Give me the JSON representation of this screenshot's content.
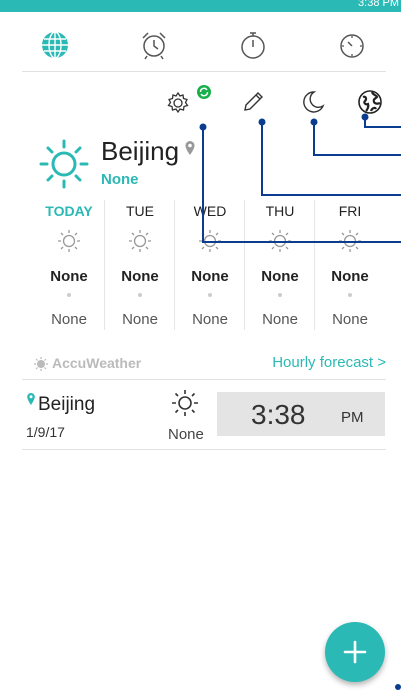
{
  "status_bar": {
    "time": "3:38 PM"
  },
  "tabs": [
    {
      "name": "world-clock",
      "icon": "globe-icon",
      "active": true
    },
    {
      "name": "alarm",
      "icon": "alarm-clock-icon"
    },
    {
      "name": "stopwatch",
      "icon": "stopwatch-icon"
    },
    {
      "name": "timer",
      "icon": "timer-icon"
    }
  ],
  "toolbar": [
    {
      "name": "settings",
      "icon": "gear-icon",
      "badge": "sync-badge"
    },
    {
      "name": "edit",
      "icon": "pencil-icon"
    },
    {
      "name": "night-mode",
      "icon": "moon-icon"
    },
    {
      "name": "add-city",
      "icon": "globe-icon"
    }
  ],
  "weather": {
    "city": "Beijing",
    "condition": "None",
    "forecast": [
      {
        "day": "TODAY",
        "high": "None",
        "low": "None"
      },
      {
        "day": "TUE",
        "high": "None",
        "low": "None"
      },
      {
        "day": "WED",
        "high": "None",
        "low": "None"
      },
      {
        "day": "THU",
        "high": "None",
        "low": "None"
      },
      {
        "day": "FRI",
        "high": "None",
        "low": "None"
      }
    ],
    "provider": "AccuWeather",
    "hourly_link": "Hourly forecast >"
  },
  "clocks": [
    {
      "city": "Beijing",
      "date": "1/9/17",
      "temp": "None",
      "time": "3:38",
      "ampm": "PM"
    }
  ],
  "colors": {
    "accent": "#2bb9b5",
    "annotation": "#0a3d8f"
  }
}
